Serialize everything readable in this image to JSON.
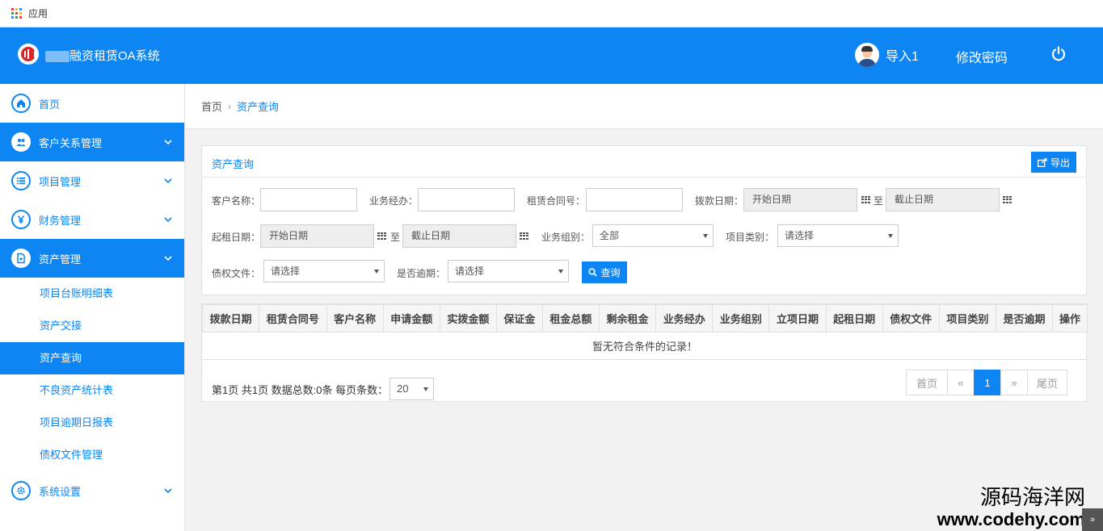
{
  "bookmarks": {
    "apps_label": "应用"
  },
  "header": {
    "system_title": "融资租赁OA系统",
    "user_name": "导入1",
    "change_password": "修改密码",
    "brand_color": "#0d86f3"
  },
  "sidebar": {
    "items": [
      {
        "label": "首页",
        "icon": "home-icon"
      },
      {
        "label": "客户关系管理",
        "icon": "users-icon"
      },
      {
        "label": "项目管理",
        "icon": "list-icon"
      },
      {
        "label": "财务管理",
        "icon": "yen-icon"
      },
      {
        "label": "资产管理",
        "icon": "document-icon"
      },
      {
        "label": "系统设置",
        "icon": "gear-icon"
      }
    ],
    "asset_sub_items": [
      "项目台账明细表",
      "资产交接",
      "资产查询",
      "不良资产统计表",
      "项目逾期日报表",
      "债权文件管理"
    ]
  },
  "breadcrumb": {
    "home": "首页",
    "current": "资产查询"
  },
  "panel": {
    "title": "资产查询",
    "export_label": "导出",
    "labels": {
      "customer": "客户名称：",
      "manager": "业务经办：",
      "contract": "租赁合同号：",
      "disburse_date": "拨款日期：",
      "start_rent": "起租日期：",
      "group": "业务组别：",
      "category": "项目类别：",
      "claim_file": "债权文件：",
      "overdue": "是否逾期："
    },
    "date_start_placeholder": "开始日期",
    "date_end_placeholder": "截止日期",
    "to_text": "至",
    "group_value": "全部",
    "category_value": "请选择",
    "claim_value": "请选择",
    "overdue_value": "请选择",
    "query_label": "查询"
  },
  "table": {
    "columns": [
      "拨款日期",
      "租赁合同号",
      "客户名称",
      "申请金额",
      "实拨金额",
      "保证金",
      "租金总额",
      "剩余租金",
      "业务经办",
      "业务组别",
      "立项日期",
      "起租日期",
      "债权文件",
      "项目类别",
      "是否逾期",
      "操作"
    ],
    "empty_text": "暂无符合条件的记录！"
  },
  "pager": {
    "info": "第1页 共1页 数据总数:0条 每页条数：",
    "page_size": "20",
    "first": "首页",
    "prev": "«",
    "current": "1",
    "next": "»",
    "last": "尾页"
  },
  "watermark": {
    "cn": "源码海洋网",
    "url": "www.codehy.com"
  }
}
